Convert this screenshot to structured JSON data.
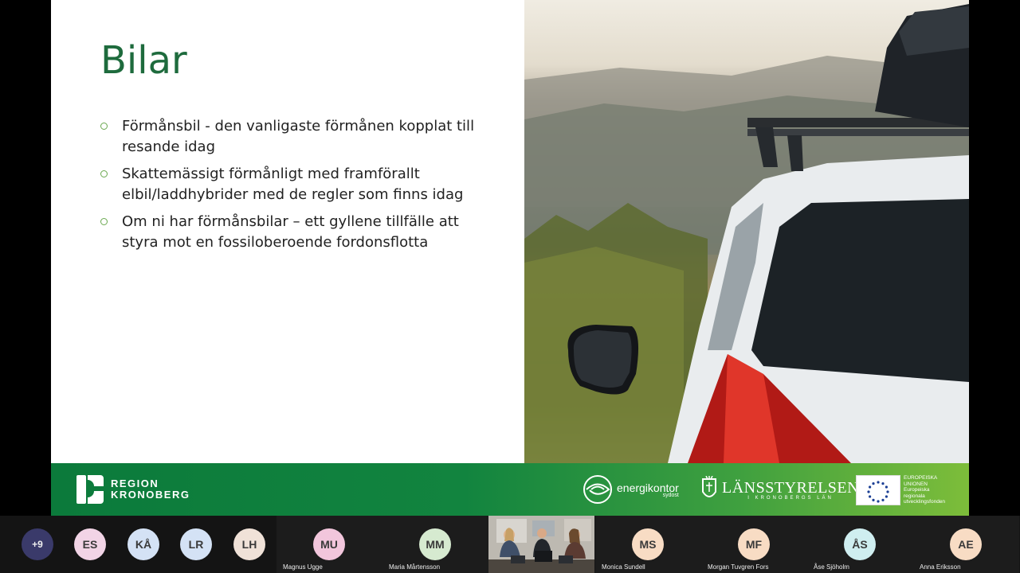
{
  "slide": {
    "title": "Bilar",
    "bullets": [
      "Förmånsbil - den vanligaste förmånen kopplat till resande idag",
      "Skattemässigt förmånligt med framförallt elbil/laddhybrider med de regler som finns idag",
      "Om ni har förmånsbilar – ett gyllene tillfälle att styra mot en fossiloberoende fordonsflotta"
    ],
    "footer": {
      "region_logo_line1": "REGION",
      "region_logo_line2": "KRONOBERG",
      "energikontor_name": "energikontor",
      "energikontor_sub": "sydost",
      "lansstyrelsen_name": "LÄNSSTYRELSEN",
      "lansstyrelsen_sub": "I KRONOBERGS LÄN",
      "eu_text": [
        "EUROPEISKA",
        "UNIONEN",
        "Europeiska",
        "regionala",
        "utvecklingsfonden"
      ]
    }
  },
  "participants": {
    "overflow_count": "+9",
    "avatars": [
      "ES",
      "KÅ",
      "LR",
      "LH"
    ],
    "tiles": [
      {
        "initials": "MU",
        "name": "Magnus Ugge",
        "color": "#f2c6dc"
      },
      {
        "initials": "MM",
        "name": "Maria Mårtensson",
        "color": "#d6ead0"
      },
      {
        "initials": "MS",
        "name": "Monica Sundell",
        "color": "#f8dcc4"
      },
      {
        "initials": "MF",
        "name": "Morgan Tuvgren Fors",
        "color": "#f8dcc4"
      },
      {
        "initials": "ÅS",
        "name": "Åse Sjöholm",
        "color": "#cfeef0"
      },
      {
        "initials": "AE",
        "name": "Anna Eriksson",
        "color": "#f8dcc4"
      }
    ],
    "avatar_colors": [
      "#f2d4e6",
      "#d4e2f5",
      "#d4e2f5",
      "#f0e2d8"
    ]
  }
}
